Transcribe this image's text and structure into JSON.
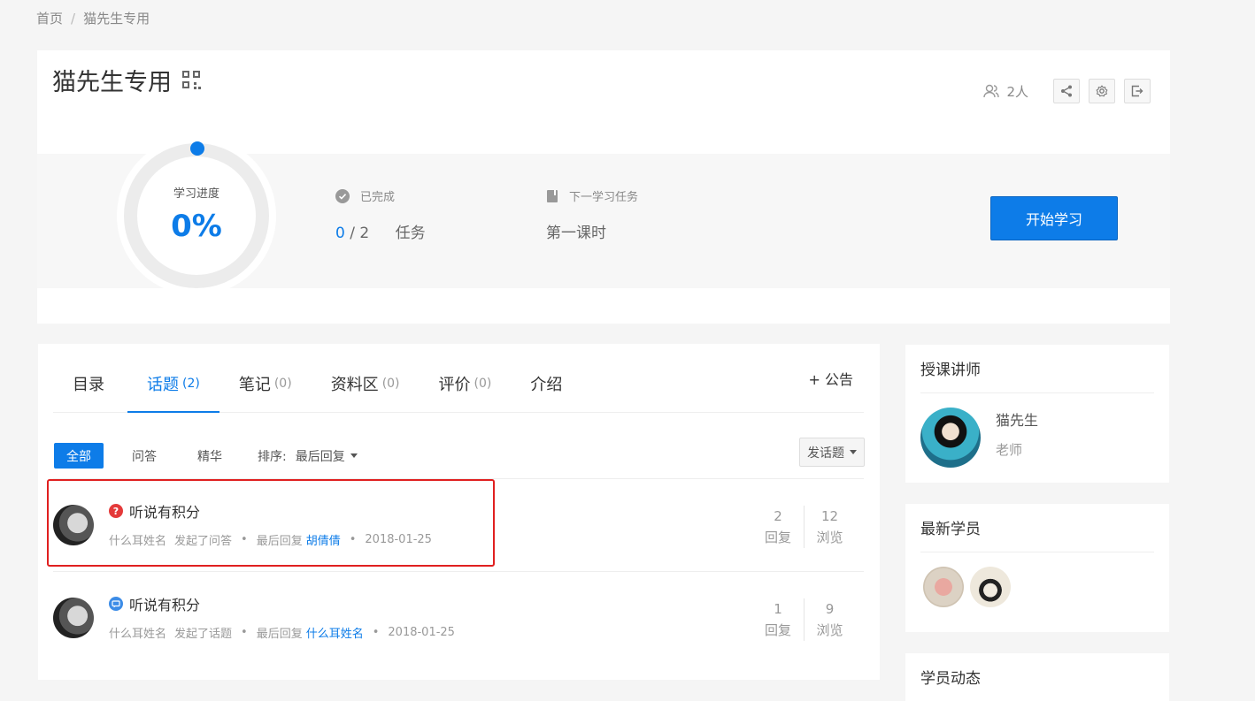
{
  "breadcrumb": {
    "home": "首页",
    "separator": "/",
    "current": "猫先生专用"
  },
  "course": {
    "title": "猫先生专用",
    "qr_icon": "qrcode-icon"
  },
  "header_actions": {
    "members_count": "2人",
    "icons": [
      "user-group-icon",
      "share-icon",
      "settings-icon",
      "exit-icon"
    ]
  },
  "progress": {
    "label": "学习进度",
    "percent_text": "0%",
    "percent": 0,
    "completed_label": "已完成",
    "completed_done": "0",
    "completed_total": "/ 2",
    "completed_unit": "任务",
    "next_label": "下一学习任务",
    "next_task": "第一课时",
    "start_button": "开始学习"
  },
  "tabs": [
    {
      "label": "目录",
      "count": ""
    },
    {
      "label": "话题",
      "count": "(2)",
      "active": true
    },
    {
      "label": "笔记",
      "count": "(0)"
    },
    {
      "label": "资料区",
      "count": "(0)"
    },
    {
      "label": "评价",
      "count": "(0)"
    },
    {
      "label": "介绍",
      "count": ""
    }
  ],
  "announcement_button": "+ 公告",
  "filters": {
    "all": "全部",
    "qa": "问答",
    "featured": "精华",
    "sort_label": "排序:",
    "sort_value": "最后回复"
  },
  "post_button": "发话题",
  "topics": [
    {
      "type": "question",
      "badge": "?",
      "title": "听说有积分",
      "author": "什么耳姓名",
      "action": "发起了问答",
      "last_reply_label": "最后回复",
      "last_reply_user": "胡倩倩",
      "date": "2018-01-25",
      "replies": "2",
      "replies_label": "回复",
      "views": "12",
      "views_label": "浏览"
    },
    {
      "type": "discussion",
      "badge": "",
      "title": "听说有积分",
      "author": "什么耳姓名",
      "action": "发起了话题",
      "last_reply_label": "最后回复",
      "last_reply_user": "什么耳姓名",
      "date": "2018-01-25",
      "replies": "1",
      "replies_label": "回复",
      "views": "9",
      "views_label": "浏览"
    }
  ],
  "sidebar": {
    "teacher_title": "授课讲师",
    "teacher_name": "猫先生",
    "teacher_role": "老师",
    "students_title": "最新学员",
    "activity_title": "学员动态"
  },
  "colors": {
    "accent": "#0d7ce8",
    "highlight": "#e02020"
  }
}
